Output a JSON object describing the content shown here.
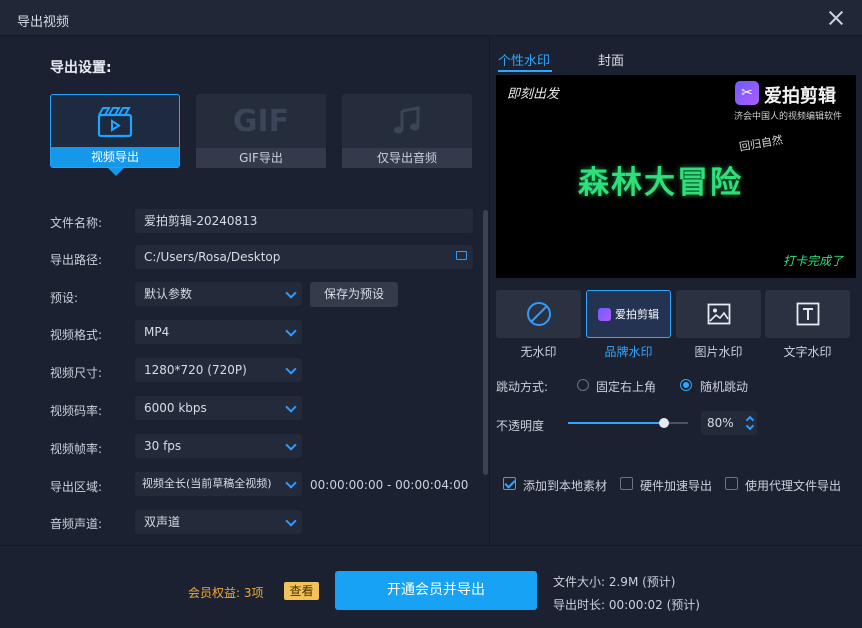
{
  "window": {
    "title": "导出视频"
  },
  "left": {
    "section_title": "导出设置:",
    "modes": [
      {
        "label": "视频导出",
        "icon": "clapperboard-icon",
        "active": true
      },
      {
        "label": "GIF导出",
        "icon_text": "GIF",
        "active": false
      },
      {
        "label": "仅导出音频",
        "icon": "music-note-icon",
        "active": false
      }
    ],
    "fields": {
      "filename": {
        "label": "文件名称:",
        "value": "爱拍剪辑-20240813"
      },
      "path": {
        "label": "导出路径:",
        "value": "C:/Users/Rosa/Desktop"
      },
      "preset": {
        "label": "预设:",
        "value": "默认参数",
        "save_label": "保存为预设"
      },
      "format": {
        "label": "视频格式:",
        "value": "MP4"
      },
      "size": {
        "label": "视频尺寸:",
        "value": "1280*720 (720P)"
      },
      "bitrate": {
        "label": "视频码率:",
        "value": "6000 kbps"
      },
      "framerate": {
        "label": "视频帧率:",
        "value": "30 fps"
      },
      "region": {
        "label": "导出区域:",
        "value": "视频全长(当前草稿全视频)",
        "range": "00:00:00:00 - 00:00:04:00"
      },
      "audio": {
        "label": "音频声道:",
        "value": "双声道"
      }
    }
  },
  "right": {
    "tabs": [
      {
        "label": "个性水印",
        "active": true
      },
      {
        "label": "封面",
        "active": false
      }
    ],
    "preview": {
      "top_left": "即刻出发",
      "brand": "爱拍剪辑",
      "slogan": "济会中国人的视频编辑软件",
      "subtitle": "回归自然",
      "main_title": "森林大冒险",
      "bottom_right": "打卡完成了"
    },
    "watermarks": [
      {
        "label": "无水印",
        "icon": "no-sign-icon",
        "active": false
      },
      {
        "label": "品牌水印",
        "chip": "爱拍剪辑",
        "active": true
      },
      {
        "label": "图片水印",
        "icon": "image-icon",
        "active": false
      },
      {
        "label": "文字水印",
        "icon": "text-icon",
        "active": false
      }
    ],
    "jump": {
      "label": "跳动方式:",
      "options": [
        {
          "label": "固定右上角",
          "selected": false
        },
        {
          "label": "随机跳动",
          "selected": true
        }
      ]
    },
    "opacity": {
      "label": "不透明度",
      "value": "80%",
      "level": 0.8
    },
    "checks": [
      {
        "label": "添加到本地素材",
        "checked": true
      },
      {
        "label": "硬件加速导出",
        "checked": false
      },
      {
        "label": "使用代理文件导出",
        "checked": false
      }
    ]
  },
  "footer": {
    "member": "会员权益: 3项",
    "view": "查看",
    "export": "开通会员并导出",
    "file_size": "文件大小: 2.9M (预计)",
    "duration": "导出时长: 00:00:02 (预计)"
  },
  "colors": {
    "accent": "#1ea5ff",
    "background": "#1b2130",
    "member": "#f0a93b",
    "preview_title": "#2fe07a"
  }
}
